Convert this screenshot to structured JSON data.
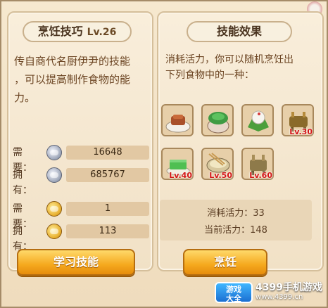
{
  "left": {
    "title": "烹饪技巧",
    "level": "Lv.26",
    "description_lines": [
      "传自商代名厨伊尹的技能",
      "，可以提高制作食物的能",
      "力。"
    ],
    "resources": [
      {
        "label": "需要：",
        "icon": "silver-coin-icon",
        "value": "16648"
      },
      {
        "label": "拥有：",
        "icon": "silver-coin-icon",
        "value": "685767"
      },
      {
        "label": "需要：",
        "icon": "gold-token-icon",
        "value": "1"
      },
      {
        "label": "拥有：",
        "icon": "gold-token-icon",
        "value": "113"
      }
    ],
    "learn_button": "学习技能"
  },
  "right": {
    "title": "技能效果",
    "effect_lines": [
      "消耗活力，你可以随机烹饪出",
      "下列食物中的一种："
    ],
    "foods": [
      {
        "name": "braised-meat-dish-icon",
        "level": ""
      },
      {
        "name": "green-dumpling-bowl-icon",
        "level": ""
      },
      {
        "name": "rice-dumpling-icon",
        "level": ""
      },
      {
        "name": "hotpot-icon",
        "level": "Lv.30"
      },
      {
        "name": "green-cake-icon",
        "level": "Lv.40"
      },
      {
        "name": "noodle-bowl-icon",
        "level": "Lv.50"
      },
      {
        "name": "bronze-ding-icon",
        "level": "Lv.60"
      }
    ],
    "stats": {
      "cost": "消耗活力：33",
      "current": "当前活力：148"
    },
    "cook_button": "烹饪"
  },
  "watermark": {
    "logo_line1": "游戏",
    "logo_line2": "大全",
    "brand": "4399手机游戏",
    "url": "www.4399.cn"
  }
}
